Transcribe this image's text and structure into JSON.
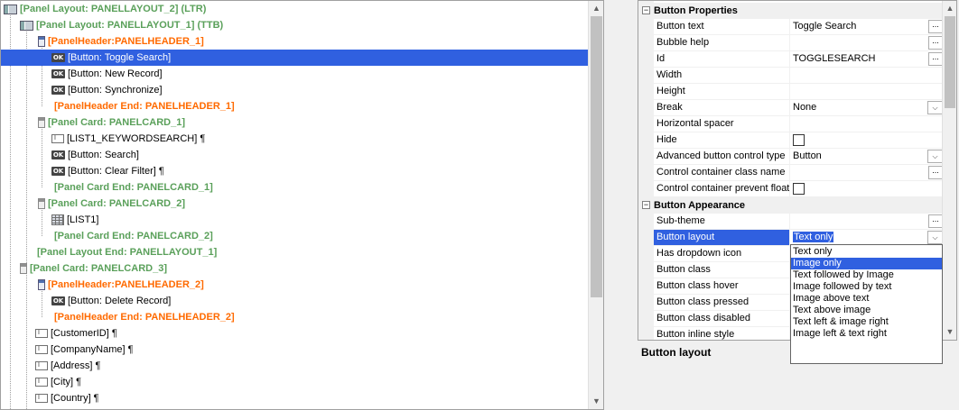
{
  "tree": {
    "rows": [
      {
        "label": "[Panel Layout: PANELLAYOUT_2] (LTR)",
        "icon": "panel-layout-icon",
        "color": "green"
      },
      {
        "label": "[Panel Layout: PANELLAYOUT_1] (TTB)",
        "icon": "panel-layout-icon",
        "color": "green"
      },
      {
        "label": "[PanelHeader:PANELHEADER_1]",
        "icon": "panel-header-icon",
        "color": "orange"
      },
      {
        "label": "[Button: Toggle Search]",
        "icon": "ok-button-icon",
        "color": "black",
        "selected": true
      },
      {
        "label": "[Button: New Record]",
        "icon": "ok-button-icon",
        "color": "black"
      },
      {
        "label": "[Button: Synchronize]",
        "icon": "ok-button-icon",
        "color": "black"
      },
      {
        "label": "[PanelHeader End: PANELHEADER_1]",
        "icon": "",
        "color": "orange"
      },
      {
        "label": "[Panel Card: PANELCARD_1]",
        "icon": "panel-card-icon",
        "color": "green"
      },
      {
        "label": "[LIST1_KEYWORDSEARCH] ¶",
        "icon": "text-field-icon",
        "color": "black"
      },
      {
        "label": "[Button: Search]",
        "icon": "ok-button-icon",
        "color": "black"
      },
      {
        "label": "[Button: Clear Filter] ¶",
        "icon": "ok-button-icon",
        "color": "black"
      },
      {
        "label": "[Panel Card End: PANELCARD_1]",
        "icon": "",
        "color": "green"
      },
      {
        "label": "[Panel Card: PANELCARD_2]",
        "icon": "panel-card-icon",
        "color": "green"
      },
      {
        "label": "[LIST1]",
        "icon": "list-grid-icon",
        "color": "black"
      },
      {
        "label": "[Panel Card End: PANELCARD_2]",
        "icon": "",
        "color": "green"
      },
      {
        "label": "[Panel Layout End: PANELLAYOUT_1]",
        "icon": "",
        "color": "green"
      },
      {
        "label": "[Panel Card: PANELCARD_3]",
        "icon": "panel-card-icon",
        "color": "green"
      },
      {
        "label": "[PanelHeader:PANELHEADER_2]",
        "icon": "panel-header-icon",
        "color": "orange"
      },
      {
        "label": "[Button: Delete Record]",
        "icon": "ok-button-icon",
        "color": "black"
      },
      {
        "label": "[PanelHeader End: PANELHEADER_2]",
        "icon": "",
        "color": "orange"
      },
      {
        "label": "[CustomerID] ¶",
        "icon": "text-field-icon",
        "color": "black"
      },
      {
        "label": "[CompanyName] ¶",
        "icon": "text-field-icon",
        "color": "black"
      },
      {
        "label": "[Address] ¶",
        "icon": "text-field-icon",
        "color": "black"
      },
      {
        "label": "[City] ¶",
        "icon": "text-field-icon",
        "color": "black"
      },
      {
        "label": "[Country] ¶",
        "icon": "text-field-icon",
        "color": "black"
      }
    ]
  },
  "properties": {
    "section1": "Button Properties",
    "section2": "Button Appearance",
    "rows1": [
      {
        "name": "Button text",
        "value": "Toggle Search",
        "editor": "ellipsis"
      },
      {
        "name": "Bubble help",
        "value": "",
        "editor": "ellipsis"
      },
      {
        "name": "Id",
        "value": "TOGGLESEARCH",
        "editor": "ellipsis"
      },
      {
        "name": "Width",
        "value": "",
        "editor": ""
      },
      {
        "name": "Height",
        "value": "",
        "editor": ""
      },
      {
        "name": "Break",
        "value": "None",
        "editor": "dropdown"
      },
      {
        "name": "Horizontal spacer",
        "value": "",
        "editor": ""
      },
      {
        "name": "Hide",
        "value": "",
        "editor": "checkbox"
      },
      {
        "name": "Advanced button control type",
        "value": "Button",
        "editor": "dropdown"
      },
      {
        "name": "Control container class name",
        "value": "",
        "editor": "ellipsis"
      },
      {
        "name": "Control container prevent float",
        "value": "",
        "editor": "checkbox"
      }
    ],
    "rows2": [
      {
        "name": "Sub-theme",
        "value": "",
        "editor": "ellipsis"
      },
      {
        "name": "Button layout",
        "value": "Text only",
        "editor": "dropdown",
        "selected": true
      },
      {
        "name": "Has dropdown icon",
        "value": "",
        "editor": ""
      },
      {
        "name": "Button class",
        "value": "",
        "editor": ""
      },
      {
        "name": "Button class hover",
        "value": "",
        "editor": ""
      },
      {
        "name": "Button class pressed",
        "value": "",
        "editor": ""
      },
      {
        "name": "Button class disabled",
        "value": "",
        "editor": ""
      },
      {
        "name": "Button inline style",
        "value": "",
        "editor": ""
      }
    ],
    "caption": "Button layout",
    "dropdown_options": [
      "Text only",
      "Image only",
      "Text followed by Image",
      "Image followed by text",
      "Image above text",
      "Text above image",
      "Text left & image right",
      "Image left & text right"
    ],
    "dropdown_highlighted": "Image only"
  },
  "icons": {
    "scroll_up": "▲",
    "scroll_down": "▼",
    "expander": "−",
    "ellipsis": "...",
    "dropdown": "⌵"
  },
  "colors": {
    "selection": "#3060e0",
    "green_label": "#5aa05a",
    "orange_label": "#ff6a00"
  }
}
